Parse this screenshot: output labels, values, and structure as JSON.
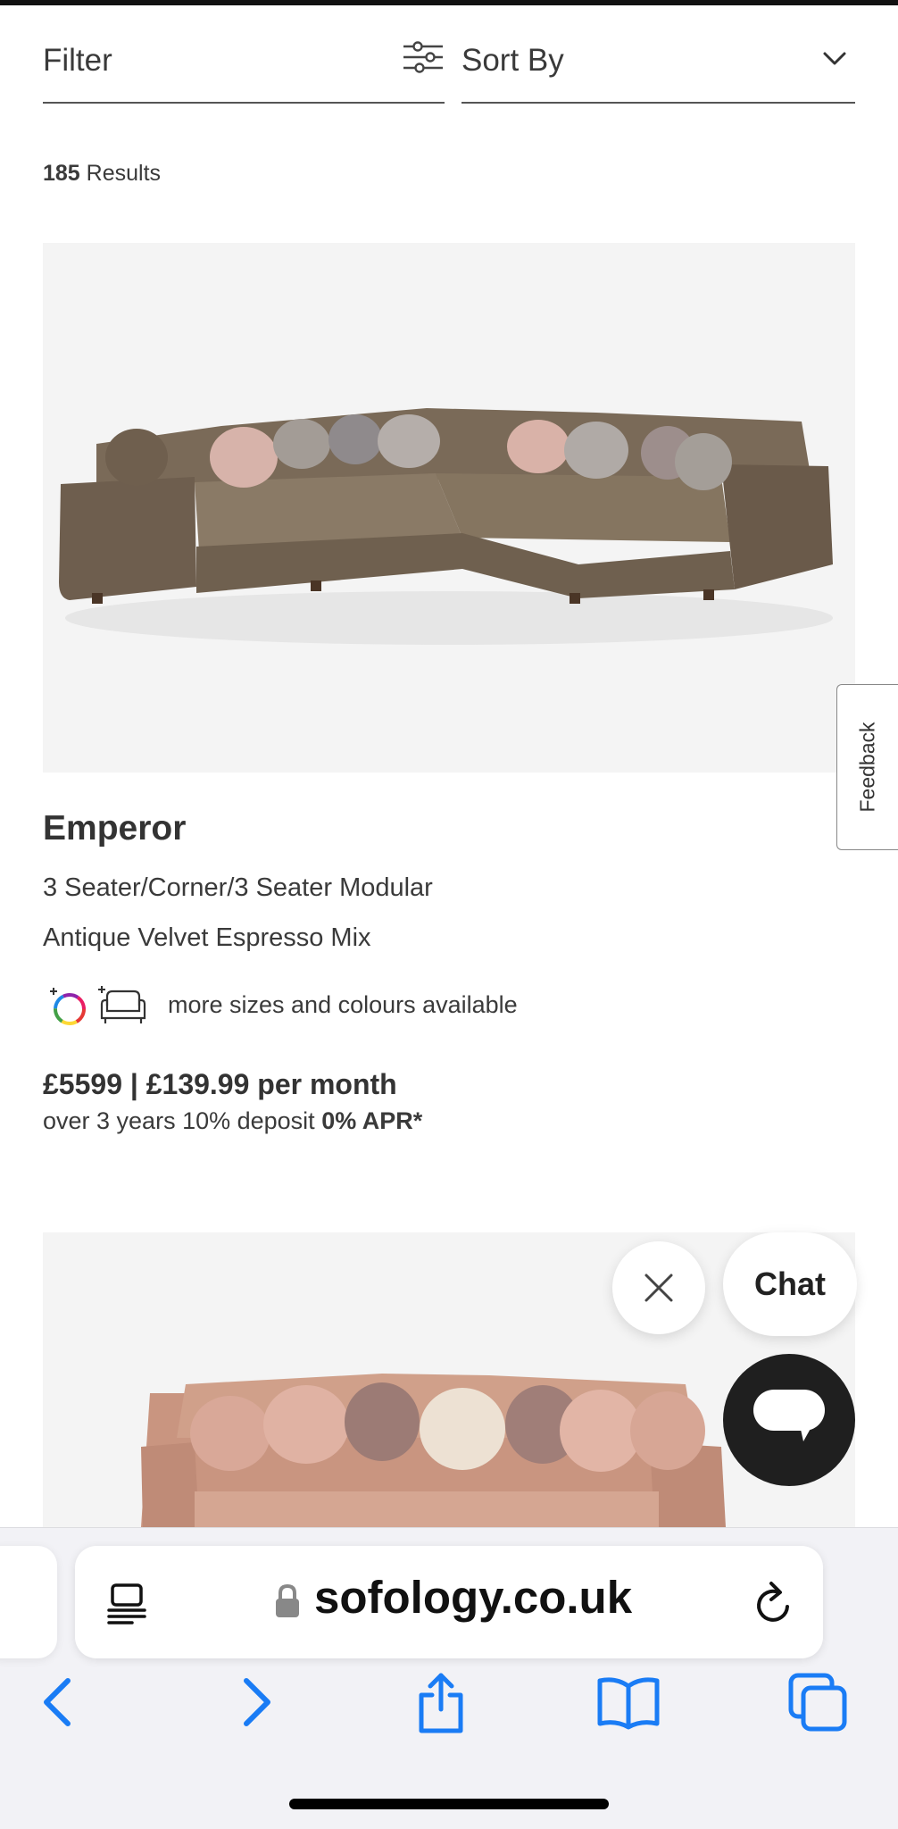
{
  "filter": {
    "label": "Filter",
    "icon": "sliders-icon"
  },
  "sort": {
    "label": "Sort By",
    "icon": "chevron-down-icon"
  },
  "results": {
    "count": "185",
    "label": "Results"
  },
  "product1": {
    "name": "Emperor",
    "configuration": "3 Seater/Corner/3 Seater Modular",
    "fabric": "Antique Velvet Espresso Mix",
    "more_options": "more sizes and colours available",
    "price": "£5599  |  £139.99 per month",
    "finance_text": "over 3 years 10% deposit",
    "finance_apr": "0% APR*"
  },
  "feedback": {
    "label": "Feedback"
  },
  "chat": {
    "label": "Chat",
    "close_icon": "close-icon",
    "bubble_icon": "chat-bubble-icon"
  },
  "browser": {
    "url": "sofology.co.uk",
    "icons": [
      "reader-icon",
      "lock-icon",
      "reload-icon",
      "back-icon",
      "forward-icon",
      "share-icon",
      "bookmarks-icon",
      "tabs-icon"
    ],
    "accent": "#1a7cf5"
  }
}
